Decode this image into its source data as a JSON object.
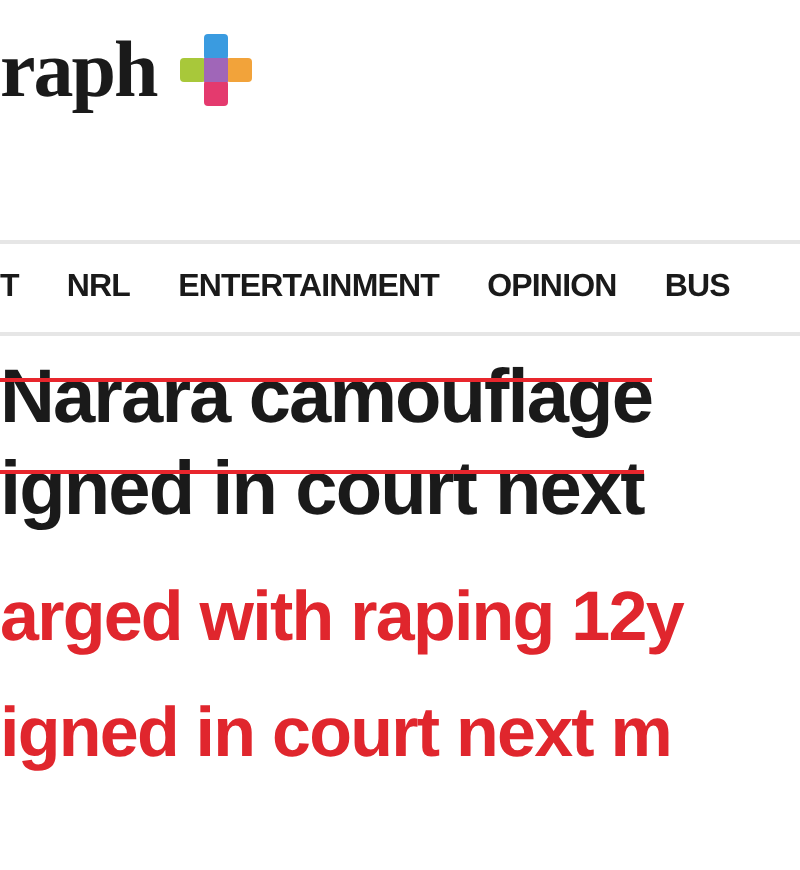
{
  "masthead": {
    "logo_text": "raph"
  },
  "nav": {
    "items": [
      {
        "label": "T"
      },
      {
        "label": "NRL"
      },
      {
        "label": "ENTERTAINMENT"
      },
      {
        "label": "OPINION"
      },
      {
        "label": "BUS"
      }
    ]
  },
  "headline": {
    "lines": [
      {
        "text": "Narara camouflage",
        "struck": true
      },
      {
        "text": "igned in court next",
        "struck": true
      }
    ]
  },
  "correction": {
    "lines": [
      "arged with raping 12y",
      "igned in court next m"
    ]
  }
}
